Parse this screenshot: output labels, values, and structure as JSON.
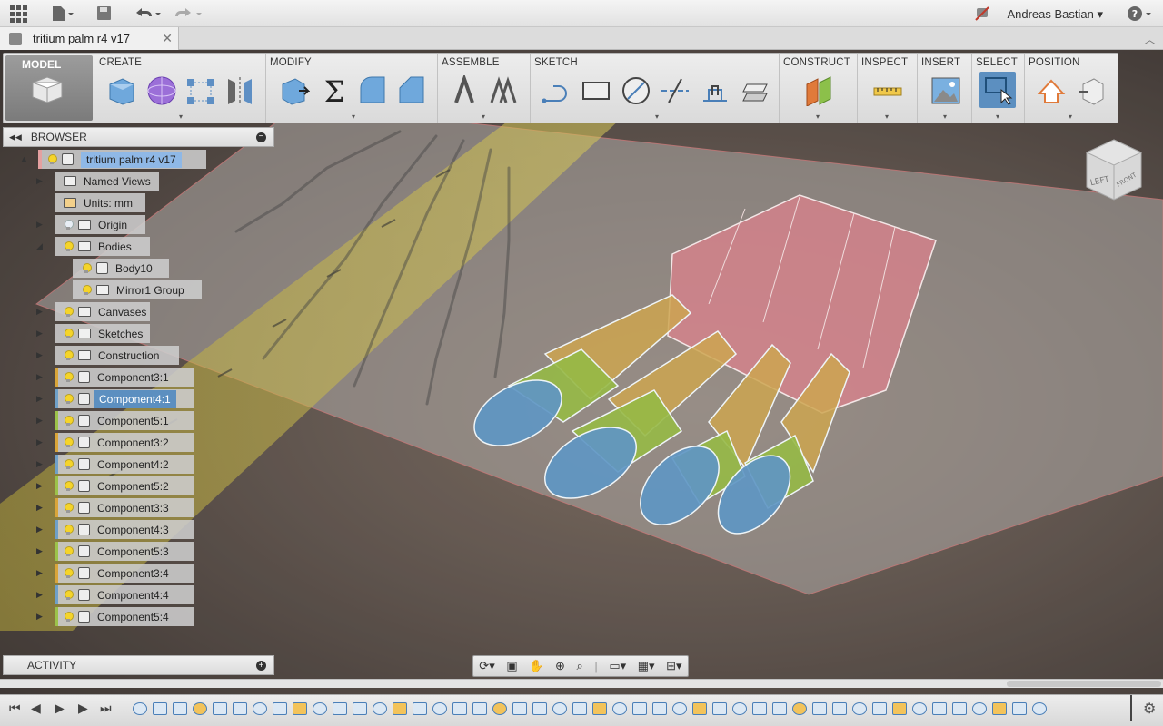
{
  "user_name": "Andreas Bastian",
  "document": {
    "tab_title": "tritium palm r4 v17",
    "close_glyph": "✕"
  },
  "ribbon": {
    "model_label": "MODEL",
    "sections": {
      "create": "CREATE",
      "modify": "MODIFY",
      "assemble": "ASSEMBLE",
      "sketch": "SKETCH",
      "construct": "CONSTRUCT",
      "inspect": "INSPECT",
      "insert": "INSERT",
      "select": "SELECT",
      "position": "POSITION"
    }
  },
  "browser": {
    "title": "BROWSER",
    "items": [
      {
        "label": "tritium palm r4 v17",
        "expand": "▲",
        "type": "root"
      },
      {
        "label": "Named Views",
        "expand": "▶",
        "type": "folder"
      },
      {
        "label": "Units: mm",
        "expand": "",
        "type": "units"
      },
      {
        "label": "Origin",
        "expand": "▶",
        "type": "folder-off"
      },
      {
        "label": "Bodies",
        "expand": "◢",
        "type": "folder"
      },
      {
        "label": "Body10",
        "expand": "",
        "type": "body"
      },
      {
        "label": "Mirror1 Group",
        "expand": "",
        "type": "folder"
      },
      {
        "label": "Canvases",
        "expand": "▶",
        "type": "folder"
      },
      {
        "label": "Sketches",
        "expand": "▶",
        "type": "folder"
      },
      {
        "label": "Construction",
        "expand": "▶",
        "type": "folder"
      },
      {
        "label": "Component3:1",
        "expand": "▶",
        "type": "component"
      },
      {
        "label": "Component4:1",
        "expand": "▶",
        "type": "component-selected"
      },
      {
        "label": "Component5:1",
        "expand": "▶",
        "type": "component"
      },
      {
        "label": "Component3:2",
        "expand": "▶",
        "type": "component"
      },
      {
        "label": "Component4:2",
        "expand": "▶",
        "type": "component"
      },
      {
        "label": "Component5:2",
        "expand": "▶",
        "type": "component"
      },
      {
        "label": "Component3:3",
        "expand": "▶",
        "type": "component"
      },
      {
        "label": "Component4:3",
        "expand": "▶",
        "type": "component"
      },
      {
        "label": "Component5:3",
        "expand": "▶",
        "type": "component"
      },
      {
        "label": "Component3:4",
        "expand": "▶",
        "type": "component"
      },
      {
        "label": "Component4:4",
        "expand": "▶",
        "type": "component"
      },
      {
        "label": "Component5:4",
        "expand": "▶",
        "type": "component"
      }
    ]
  },
  "activity": {
    "title": "ACTIVITY"
  },
  "viewcube": {
    "left": "LEFT",
    "front": "FRONT"
  },
  "icons": [
    "grid-apps-icon",
    "file-icon",
    "save-icon",
    "undo-icon",
    "redo-icon",
    "no-notification-icon",
    "help-icon"
  ],
  "colors": {
    "component3": "#d9a53a",
    "component4": "#6fa0c8",
    "component5": "#9cc24a",
    "selection": "#5c8fc0"
  }
}
